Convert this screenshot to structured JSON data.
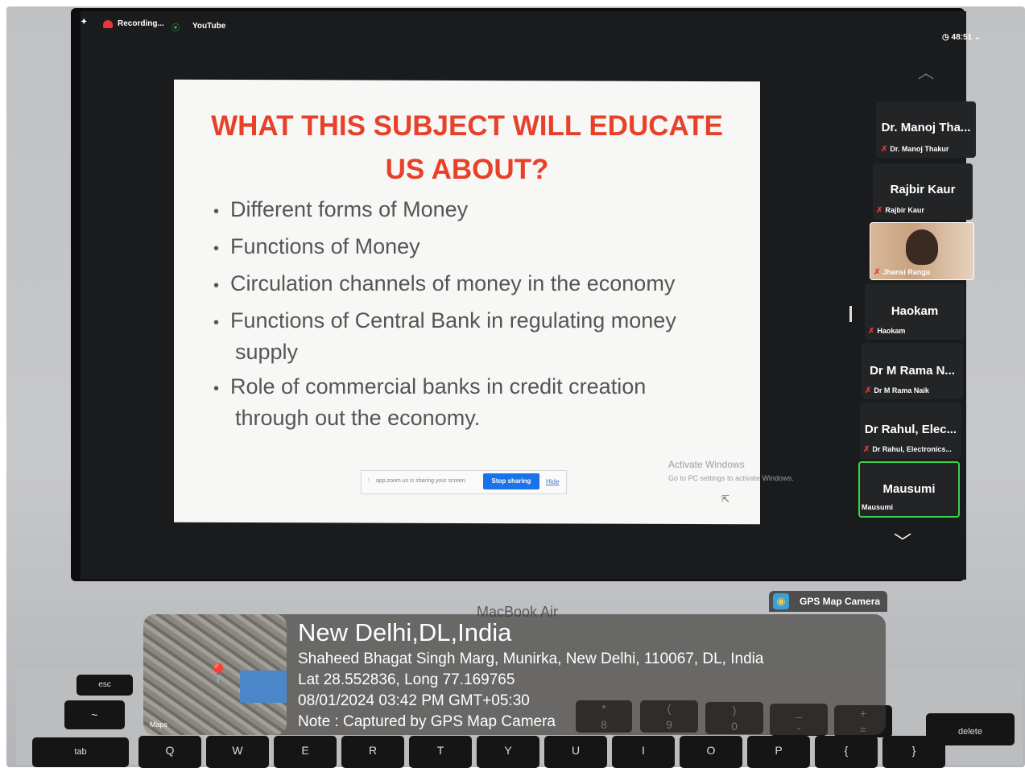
{
  "topbar": {
    "recording_label": "Recording...",
    "youtube_label": "YouTube",
    "timer": "48:51"
  },
  "slide": {
    "title_line1": "WHAT THIS SUBJECT WILL EDUCATE",
    "title_line2": "US ABOUT?",
    "bullets": [
      {
        "line1": "Different forms of Money",
        "line2": ""
      },
      {
        "line1": "Functions of Money",
        "line2": ""
      },
      {
        "line1": "Circulation channels of money in the economy",
        "line2": ""
      },
      {
        "line1": "Functions of Central Bank in regulating money",
        "line2": "supply"
      },
      {
        "line1": "Role of commercial banks in credit  creation",
        "line2": "through out the economy."
      }
    ]
  },
  "share_bar": {
    "message": "app.zoom.us is sharing your screen.",
    "stop_label": "Stop sharing",
    "hide_label": "Hide"
  },
  "activate_windows": {
    "title": "Activate Windows",
    "subtitle": "Go to PC settings to activate Windows."
  },
  "participants": [
    {
      "display": "Dr. Manoj Tha...",
      "name": "Dr. Manoj Thakur",
      "video": false,
      "active": false
    },
    {
      "display": "Rajbir Kaur",
      "name": "Rajbir Kaur",
      "video": false,
      "active": false
    },
    {
      "display": "",
      "name": "Jhansi Rangu",
      "video": true,
      "active": false
    },
    {
      "display": "Haokam",
      "name": "Haokam",
      "video": false,
      "active": false
    },
    {
      "display": "Dr M Rama N...",
      "name": "Dr M Rama Naik",
      "video": false,
      "active": false
    },
    {
      "display": "Dr Rahul, Elec...",
      "name": "Dr Rahul, Electronics...",
      "video": false,
      "active": false
    },
    {
      "display": "Mausumi",
      "name": "Mausumi",
      "video": false,
      "active": true
    }
  ],
  "laptop_label": "MacBook Air",
  "gps": {
    "badge": "GPS Map Camera",
    "city": "New Delhi,DL,India",
    "address": "Shaheed Bhagat Singh Marg, Munirka, New Delhi, 110067, DL, India",
    "coords": "Lat 28.552836, Long 77.169765",
    "datetime": "08/01/2024 03:42 PM GMT+05:30",
    "note": "Note : Captured by GPS Map Camera",
    "map_label": "Maps"
  },
  "keys": [
    "esc",
    "tab",
    "Q",
    "W",
    "E",
    "R",
    "T",
    "Y",
    "U",
    "I",
    "O",
    "P",
    "{",
    "}",
    "delete",
    "~",
    "*",
    "(",
    ")",
    "_",
    "+",
    "8",
    "9",
    "0",
    "-",
    "="
  ]
}
